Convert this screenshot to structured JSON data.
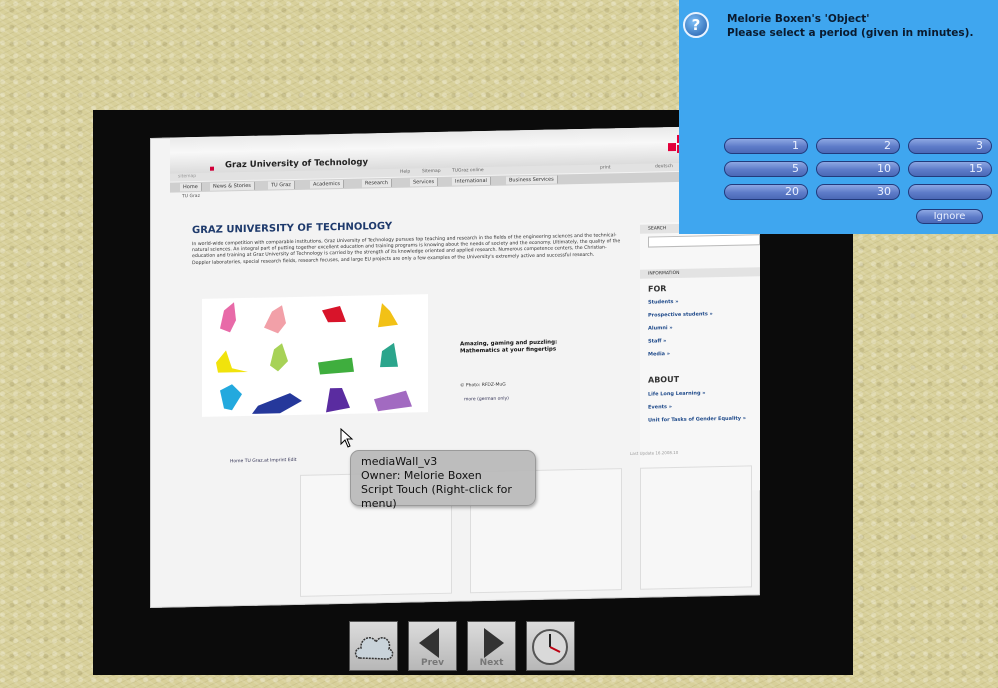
{
  "browser": {
    "univ_name": "Graz University of Technology",
    "util": [
      "Help",
      "Sitemap",
      "TUGraz online",
      "print",
      "deutsch"
    ],
    "nav": [
      "Home",
      "News & Stories",
      "TU Graz",
      "Academics",
      "Research",
      "Services",
      "International",
      "Business Services"
    ],
    "breadcrumb": "TU Graz",
    "page_title": "GRAZ UNIVERSITY OF TECHNOLOGY",
    "intro": "In world-wide competition with comparable institutions, Graz University of Technology pursues top teaching and research in the fields of the engineering sciences and the technical-natural sciences. An integral part of putting together excellent education and training programs is knowing about the needs of society and the economy. Ultimately, the quality of the education and training at Graz University of Technology is carried by the strength of its knowledge oriented and applied research. Numerous competence centers, the Christian-Doppler laboratories, special research fields, research focuses, and large EU projects are only a few examples of the University's extremely active and successful research.",
    "caption": "Amazing, gaming and puzzling: Mathematics at your fingertips",
    "photo_credit": "© Photo: RFDZ-MuG",
    "more_link": "more (german only)",
    "search_label": "SEARCH",
    "info_label": "INFORMATION",
    "for_heading": "FOR",
    "for_links": [
      "Students »",
      "Prospective students »",
      "Alumni »",
      "Staff »",
      "Media »"
    ],
    "about_heading": "ABOUT",
    "about_links": [
      "Life Long Learning »",
      "Events »",
      "Unit for Tasks of Gender Equality »"
    ],
    "footer_links": "Home TU Graz.at  Imprint  Edit",
    "footer_right": "Last Update 16.2008.10"
  },
  "tooltip": {
    "line1": "mediaWall_v3",
    "line2": "Owner: Melorie Boxen",
    "line3": "Script Touch (Right-click for menu)"
  },
  "dialog": {
    "icon": "question-icon",
    "title": "Melorie Boxen's 'Object'",
    "subtitle": "Please select a period (given in minutes).",
    "buttons": [
      "1",
      "2",
      "3",
      "5",
      "10",
      "15",
      "20",
      "30",
      ""
    ],
    "ignore_label": "Ignore"
  },
  "toolbar": {
    "prev_label": "Prev",
    "next_label": "Next"
  }
}
